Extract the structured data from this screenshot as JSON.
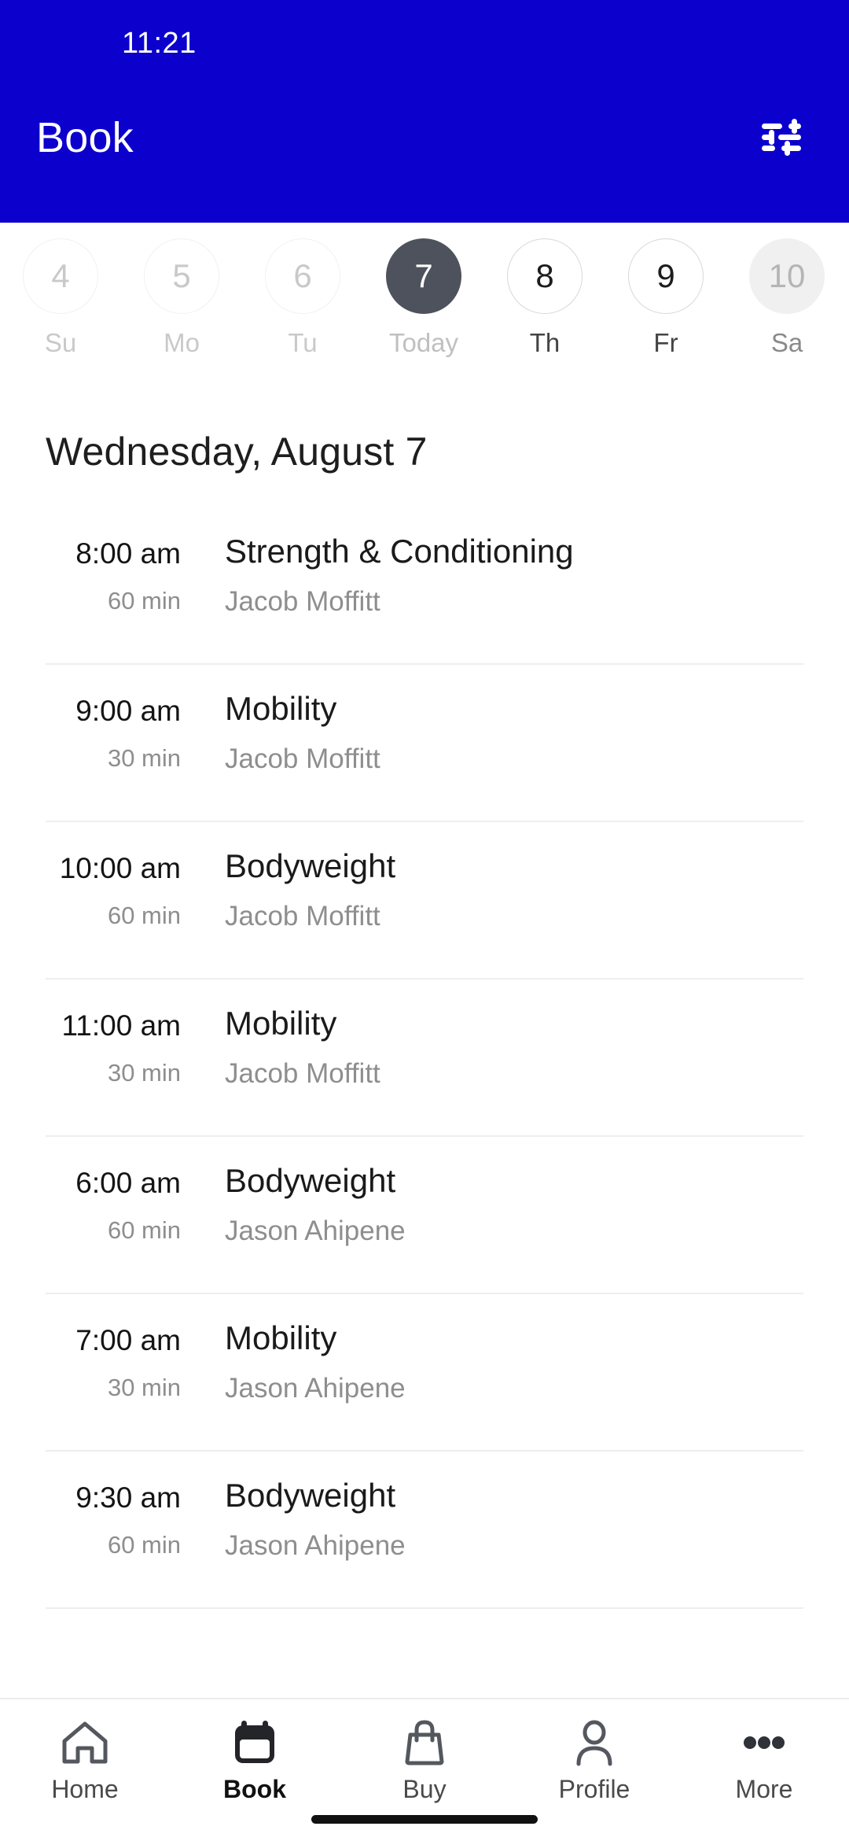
{
  "status_bar": {
    "time": "11:21"
  },
  "app_bar": {
    "title": "Book",
    "filter_icon": "tune-filter-icon",
    "background_color": "#0B00CC",
    "text_color": "#FFFFFF"
  },
  "date_strip": {
    "days": [
      {
        "number": "4",
        "label": "Su",
        "state": "disabled"
      },
      {
        "number": "5",
        "label": "Mo",
        "state": "disabled"
      },
      {
        "number": "6",
        "label": "Tu",
        "state": "disabled"
      },
      {
        "number": "7",
        "label": "Today",
        "state": "selected"
      },
      {
        "number": "8",
        "label": "Th",
        "state": "active"
      },
      {
        "number": "9",
        "label": "Fr",
        "state": "active"
      },
      {
        "number": "10",
        "label": "Sa",
        "state": "muted"
      }
    ],
    "selected_color": "#4E525C"
  },
  "schedule": {
    "heading": "Wednesday, August 7",
    "sessions": [
      {
        "time": "8:00 am",
        "duration": "60 min",
        "class_name": "Strength & Conditioning",
        "instructor": "Jacob Moffitt"
      },
      {
        "time": "9:00 am",
        "duration": "30 min",
        "class_name": "Mobility",
        "instructor": "Jacob Moffitt"
      },
      {
        "time": "10:00 am",
        "duration": "60 min",
        "class_name": "Bodyweight",
        "instructor": "Jacob Moffitt"
      },
      {
        "time": "11:00 am",
        "duration": "30 min",
        "class_name": "Mobility",
        "instructor": "Jacob Moffitt"
      },
      {
        "time": "6:00 am",
        "duration": "60 min",
        "class_name": "Bodyweight",
        "instructor": "Jason Ahipene"
      },
      {
        "time": "7:00 am",
        "duration": "30 min",
        "class_name": "Mobility",
        "instructor": "Jason Ahipene"
      },
      {
        "time": "9:30 am",
        "duration": "60 min",
        "class_name": "Bodyweight",
        "instructor": "Jason Ahipene"
      }
    ]
  },
  "tab_bar": {
    "tabs": [
      {
        "label": "Home",
        "icon": "home-icon",
        "active": false
      },
      {
        "label": "Book",
        "icon": "calendar-icon",
        "active": true
      },
      {
        "label": "Buy",
        "icon": "shopping-bag-icon",
        "active": false
      },
      {
        "label": "Profile",
        "icon": "person-icon",
        "active": false
      },
      {
        "label": "More",
        "icon": "ellipsis-icon",
        "active": false
      }
    ]
  }
}
